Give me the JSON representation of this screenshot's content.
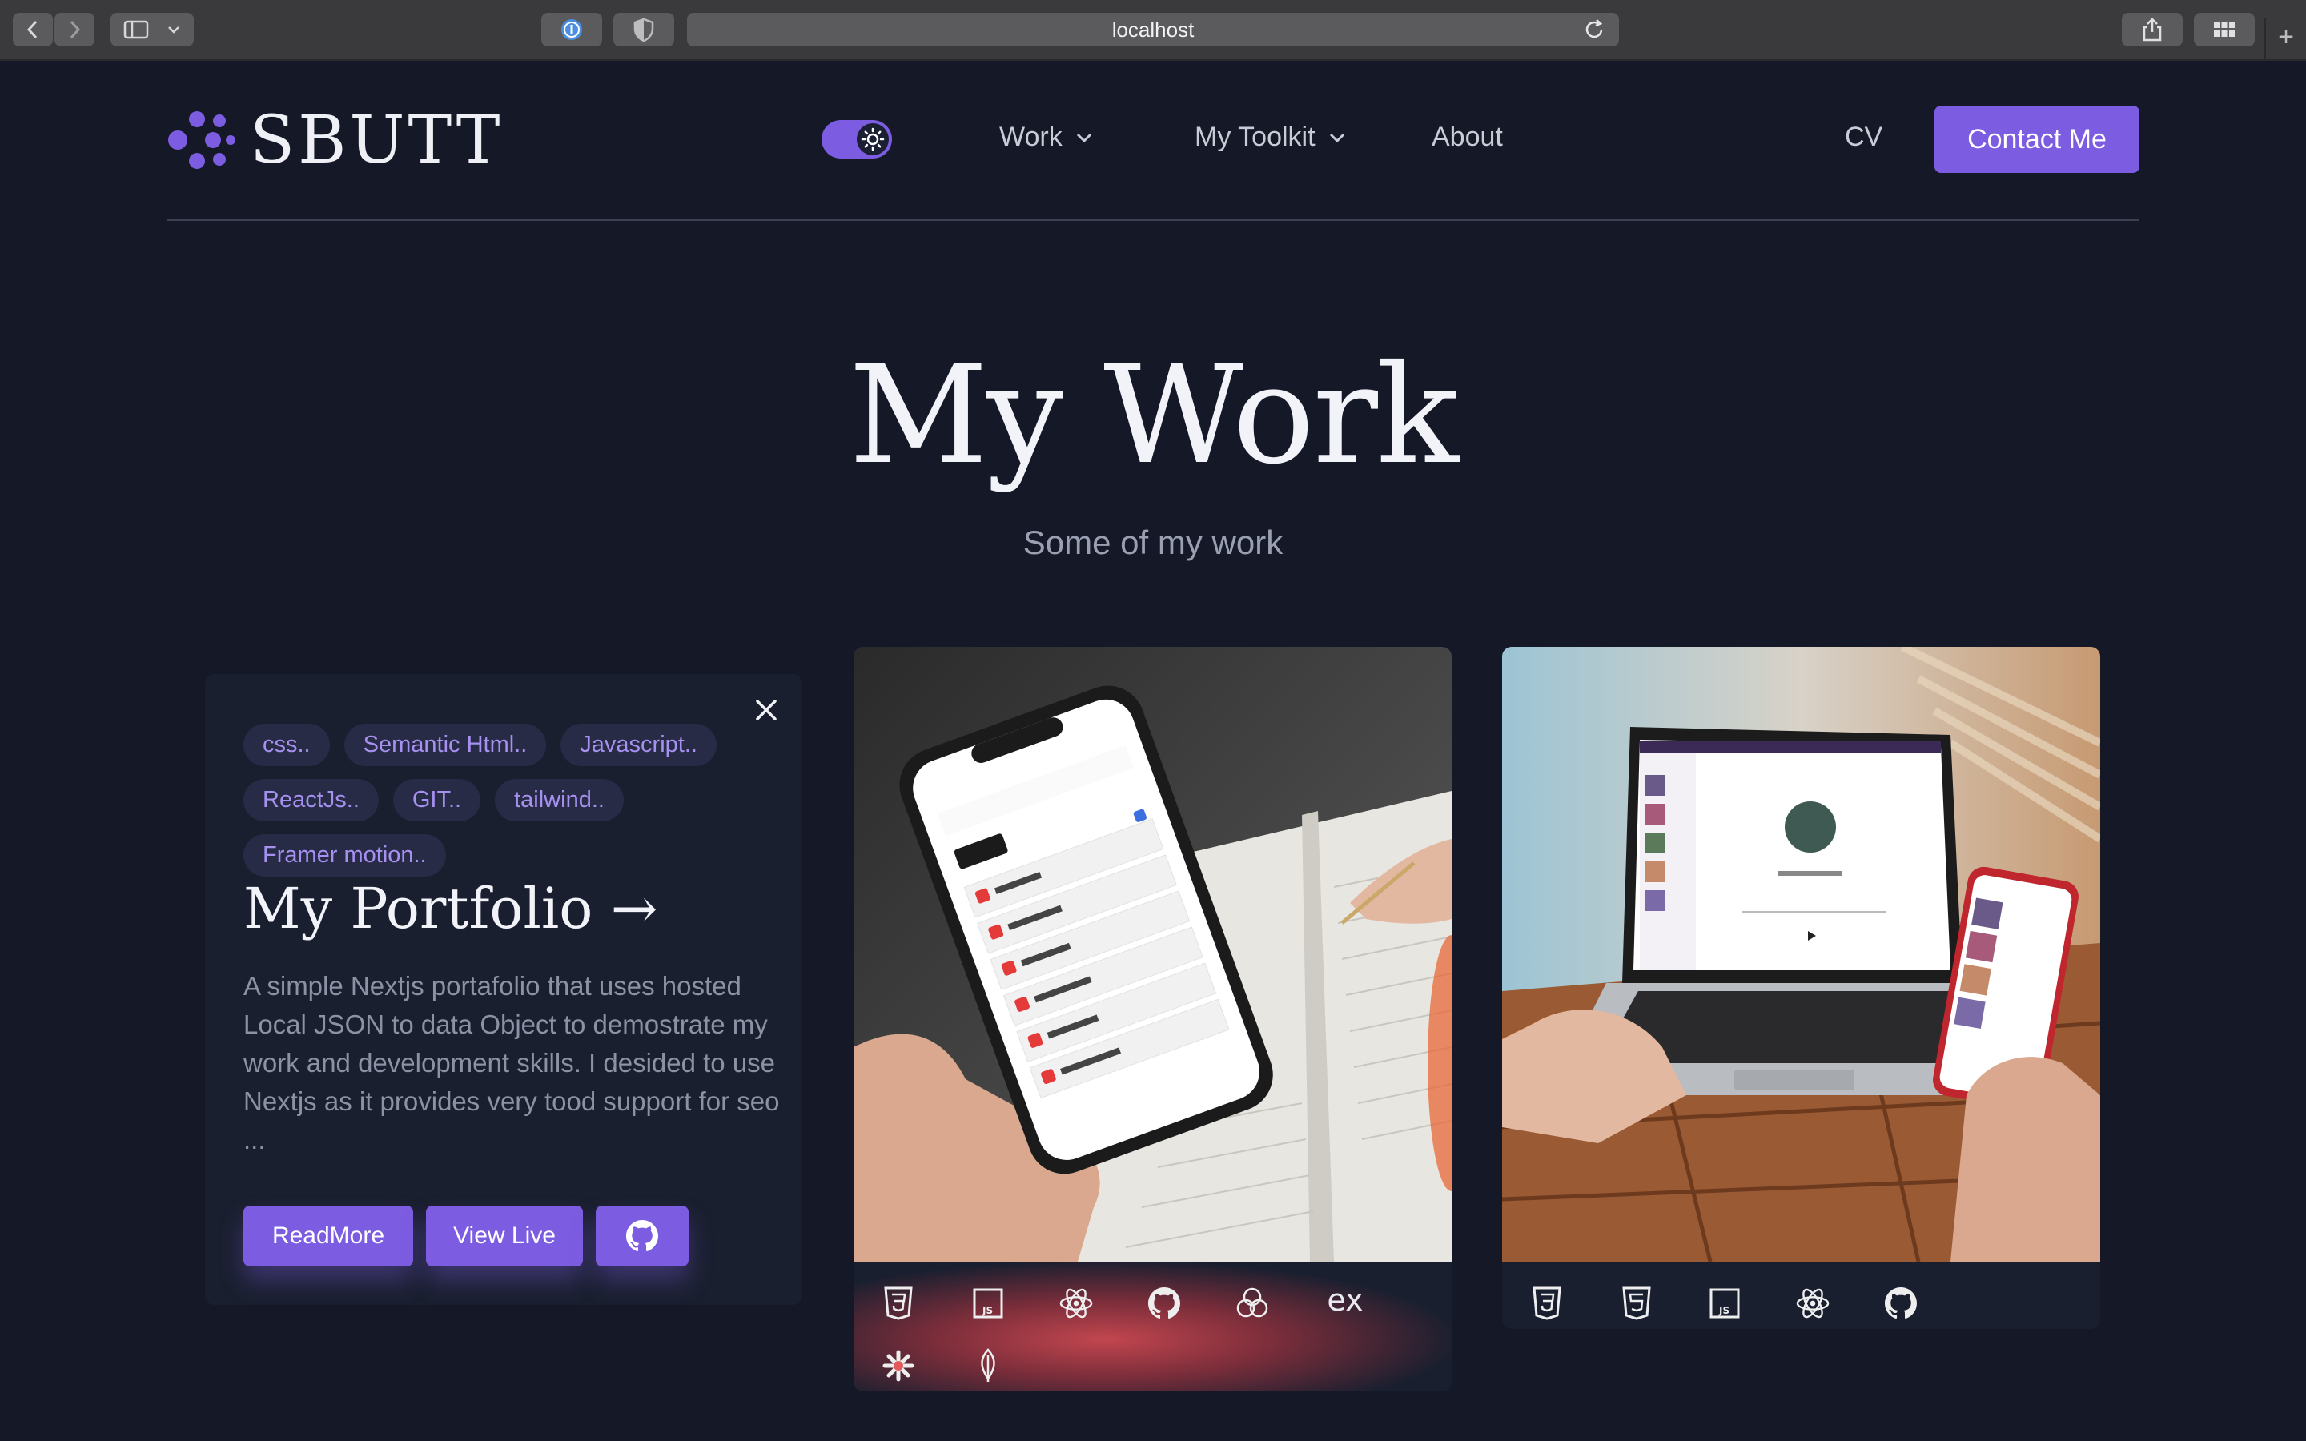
{
  "browser": {
    "url": "localhost",
    "new_tab": "+"
  },
  "nav": {
    "logo_text": "SBUTT",
    "links": [
      {
        "label": "Work"
      },
      {
        "label": "My Toolkit"
      },
      {
        "label": "About"
      },
      {
        "label": "CV"
      }
    ],
    "contact_label": "Contact Me",
    "theme_toggle_on": true
  },
  "hero": {
    "title": "My Work",
    "subtitle": "Some of my work"
  },
  "project_card": {
    "tags": [
      "css..",
      "Semantic Html..",
      "Javascript..",
      "ReactJs..",
      "GIT..",
      "tailwind..",
      "Framer motion.."
    ],
    "title": "My Portfolio →",
    "description": "A simple Nextjs portafolio that uses hosted Local JSON to data Object to demostrate my work and development skills. I desided to use Nextjs as it provides very tood support for seo ...",
    "buttons": {
      "read_more": "ReadMore",
      "view_live": "View Live"
    }
  },
  "card2": {
    "tech_icons": [
      "css3-icon",
      "javascript-icon",
      "react-icon",
      "github-icon",
      "framer-icon",
      "express-icon",
      "svelte-icon",
      "mongodb-icon"
    ],
    "express_text": "ex"
  },
  "card3": {
    "tech_icons": [
      "css3-icon",
      "html5-icon",
      "javascript-icon",
      "react-icon",
      "github-icon"
    ]
  },
  "colors": {
    "accent": "#7c5ce0",
    "background": "#141827",
    "card": "#1a1f2f"
  }
}
